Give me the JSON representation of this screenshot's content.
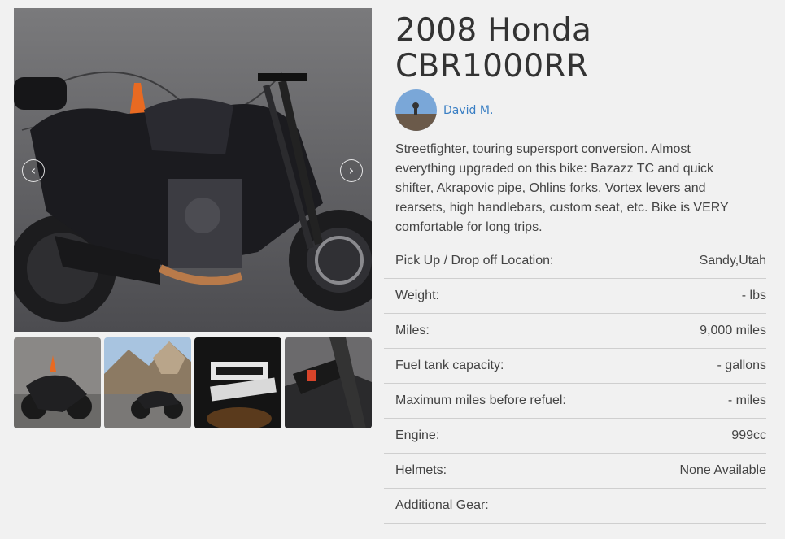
{
  "listing": {
    "title": "2008 Honda CBR1000RR",
    "owner_name": "David M.",
    "description": "Streetfighter, touring supersport conversion. Almost everything upgraded on this bike: Bazazz TC and quick shifter, Akrapovic pipe, Ohlins forks, Vortex levers and rearsets, high handlebars, custom seat, etc. Bike is VERY comfortable for long trips."
  },
  "gallery": {
    "prev_icon": "chevron-left-icon",
    "next_icon": "chevron-right-icon",
    "prev_glyph": "‹",
    "next_glyph": "›",
    "thumbnail_count": 4
  },
  "specs": [
    {
      "label": "Pick Up / Drop off Location:",
      "value": "Sandy,Utah"
    },
    {
      "label": "Weight:",
      "value": "- lbs"
    },
    {
      "label": "Miles:",
      "value": "9,000 miles"
    },
    {
      "label": "Fuel tank capacity:",
      "value": "- gallons"
    },
    {
      "label": "Maximum miles before refuel:",
      "value": "- miles"
    },
    {
      "label": "Engine:",
      "value": "999cc"
    },
    {
      "label": "Helmets:",
      "value": "None Available"
    },
    {
      "label": "Additional Gear:",
      "value": ""
    }
  ],
  "colors": {
    "background": "#f1f1f1",
    "link": "#3a7fc4",
    "divider": "#cfcfcf",
    "text": "#444444"
  }
}
